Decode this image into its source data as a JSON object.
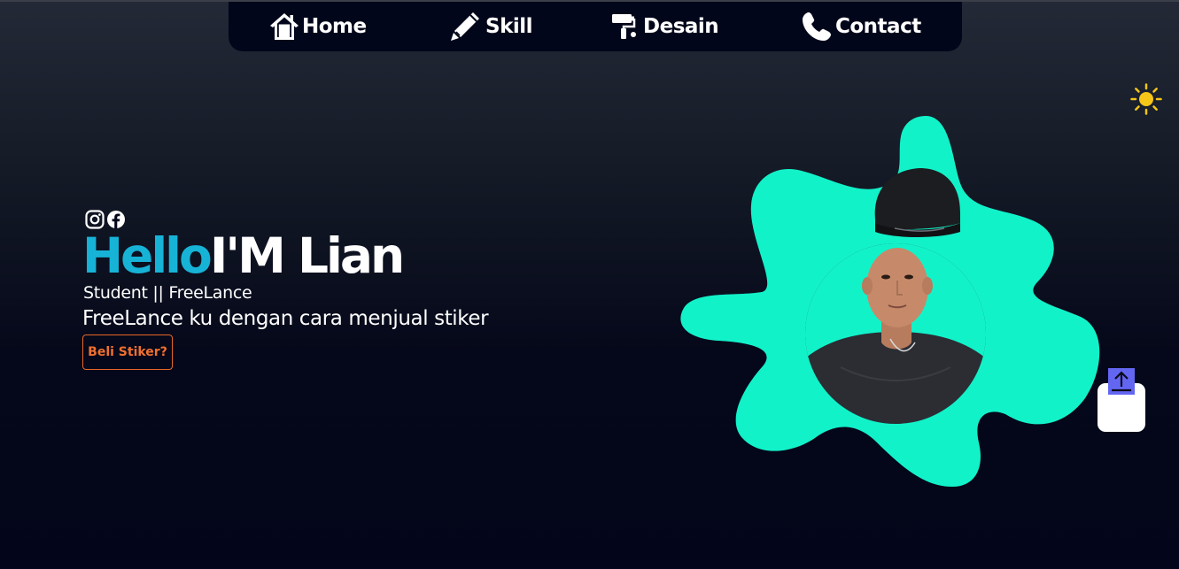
{
  "nav": {
    "items": [
      {
        "label": "Home",
        "icon": "home-icon"
      },
      {
        "label": "Skill",
        "icon": "pencil-icon"
      },
      {
        "label": "Desain",
        "icon": "paint-roller-icon"
      },
      {
        "label": "Contact",
        "icon": "phone-icon"
      }
    ]
  },
  "theme_toggle": {
    "icon": "sun-icon",
    "color": "#f5c518"
  },
  "hero": {
    "social": [
      {
        "icon": "instagram-icon"
      },
      {
        "icon": "facebook-icon"
      }
    ],
    "hello": "Hello",
    "name": "I'M Lian",
    "role": "Student || FreeLance",
    "description": "FreeLance ku dengan cara menjual stiker",
    "button_label": "Beli Stiker?"
  },
  "profile": {
    "blob_color": "#12f2c9"
  },
  "scroll_top": {
    "icon": "arrow-up-icon",
    "color": "#6366f1"
  },
  "colors": {
    "accent": "#17b3d6",
    "button": "#f07030",
    "blob": "#12f2c9"
  }
}
